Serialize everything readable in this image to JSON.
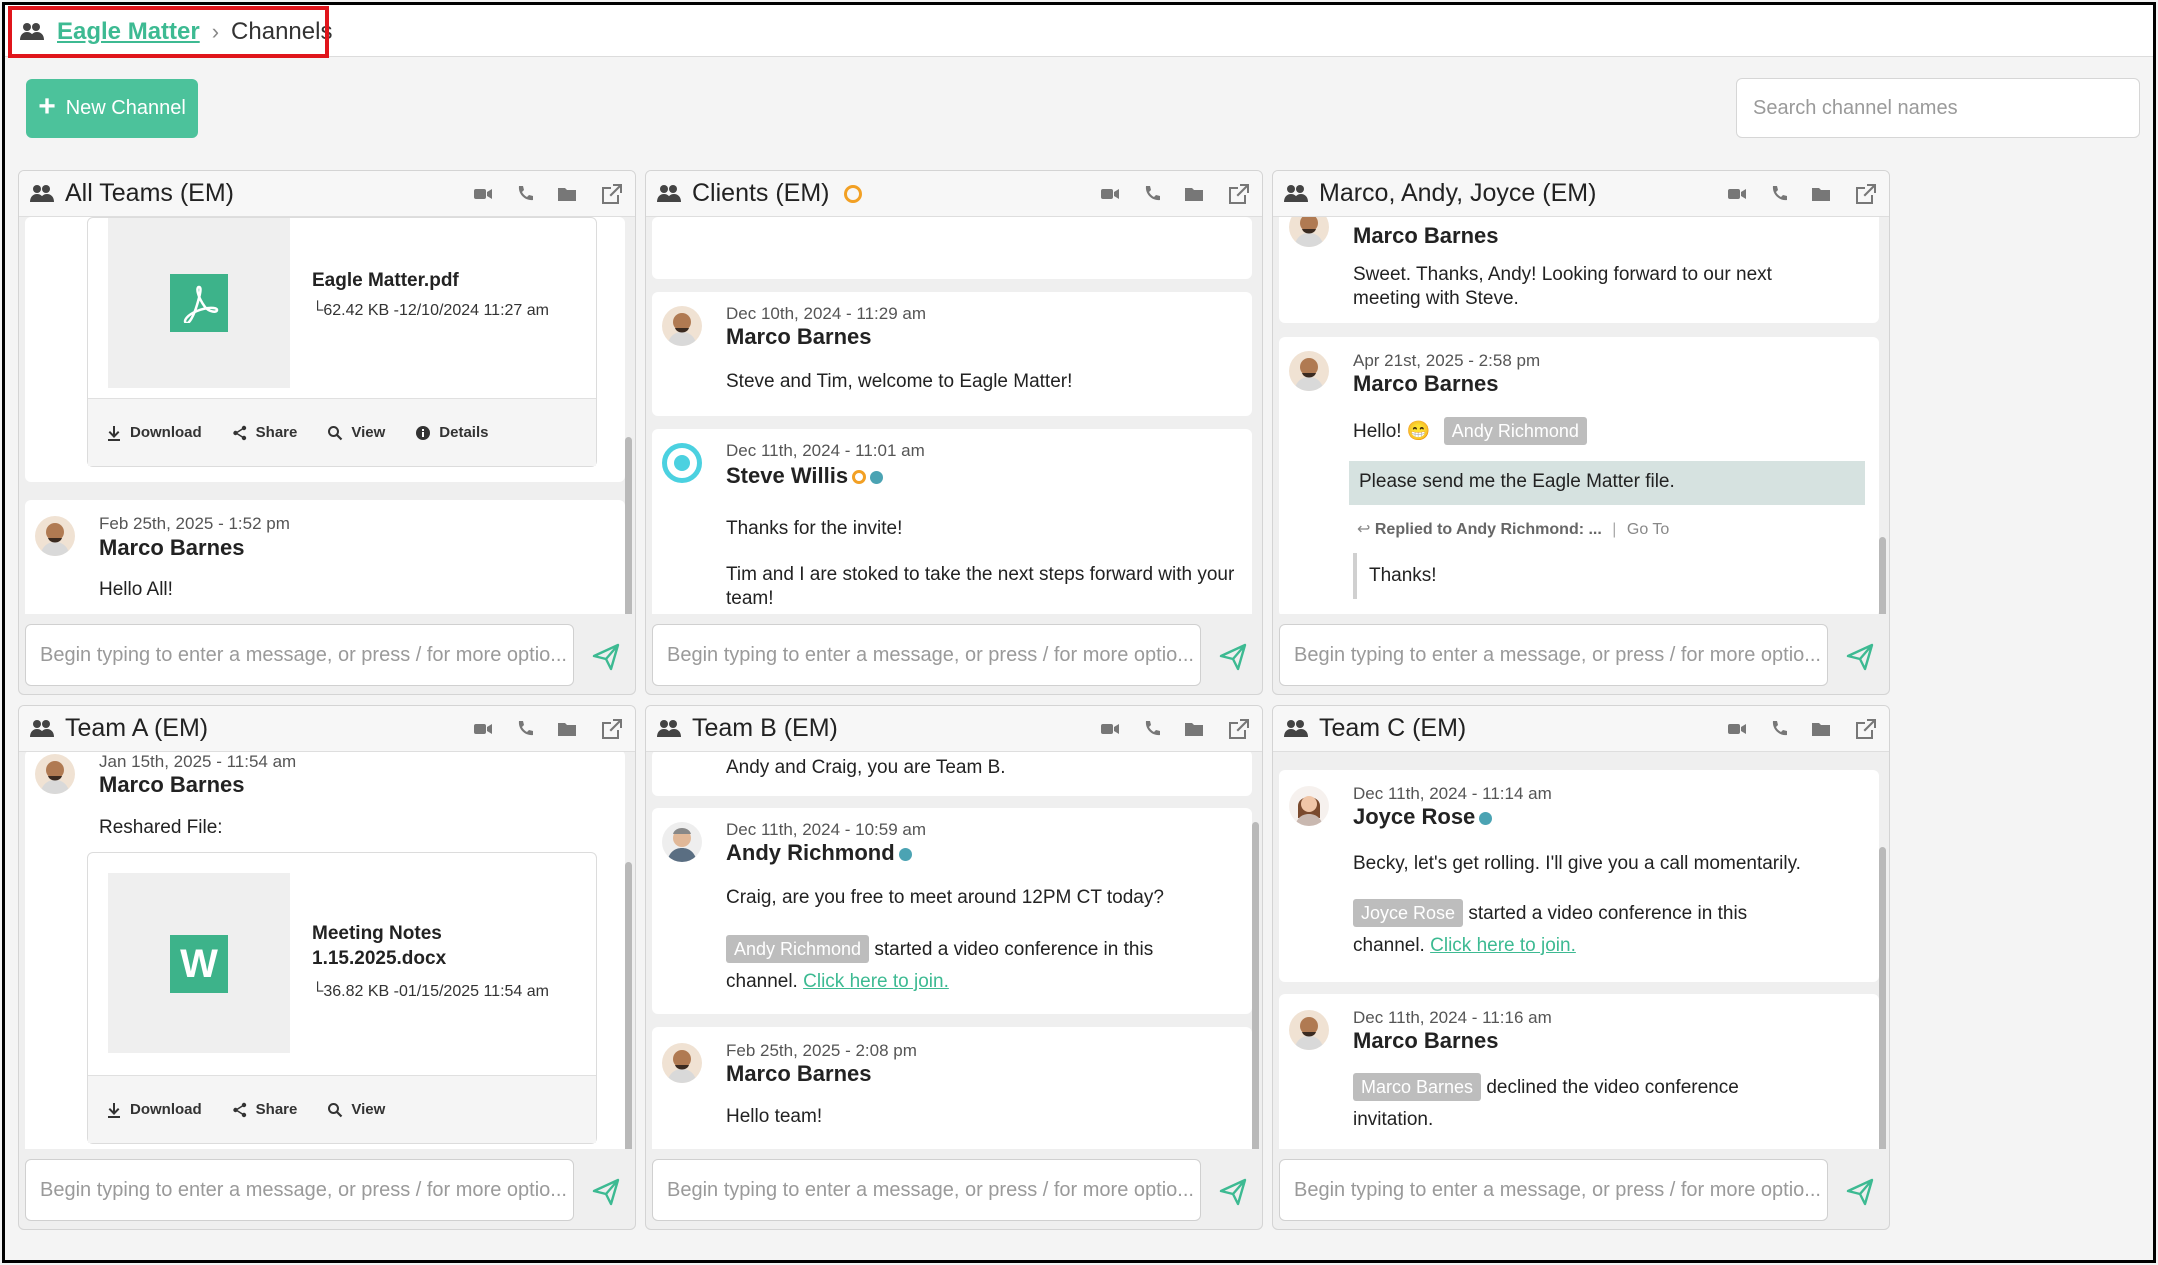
{
  "breadcrumb": {
    "parent": "Eagle Matter",
    "separator": "›",
    "current": "Channels"
  },
  "toolbar": {
    "new_channel_label": "New Channel",
    "search_placeholder": "Search channel names"
  },
  "composer_placeholder": "Begin typing to enter a message, or press / for more optio...",
  "colors": {
    "accent": "#4cc29b",
    "link": "#3dba92",
    "highlight": "#e0151b"
  },
  "panels": [
    {
      "title": "All Teams (EM)",
      "file": {
        "name": "Eagle Matter.pdf",
        "size": "└62.42 KB -12/10/2024 11:27 am",
        "actions": [
          "Download",
          "Share",
          "View",
          "Details"
        ]
      },
      "messages": [
        {
          "time": "Feb 25th, 2025 - 1:52 pm",
          "author": "Marco Barnes",
          "text": "Hello All!"
        }
      ]
    },
    {
      "title": "Clients (EM)",
      "messages": [
        {
          "time": "Dec 10th, 2024 - 11:29 am",
          "author": "Marco Barnes",
          "text": "Steve and Tim, welcome to Eagle Matter!"
        },
        {
          "time": "Dec 11th, 2024 - 11:01 am",
          "author": "Steve Willis",
          "text": "Thanks for the invite!",
          "text2": "Tim and I are stoked to take the next steps forward with your team!"
        }
      ]
    },
    {
      "title": "Marco, Andy, Joyce (EM)",
      "messages": [
        {
          "author": "Marco Barnes",
          "text": "Sweet. Thanks, Andy! Looking forward to our next meeting with Steve."
        },
        {
          "time": "Apr 21st, 2025 - 2:58 pm",
          "author": "Marco Barnes",
          "text": "Hello! 😁",
          "mention": "Andy Richmond",
          "quote": "Please send me the Eagle Matter file.",
          "replied": "Replied to Andy Richmond: ...",
          "goto": "Go To",
          "reply": "Thanks!"
        }
      ]
    },
    {
      "title": "Team A (EM)",
      "messages": [
        {
          "time": "Jan 15th, 2025 - 11:54 am",
          "author": "Marco Barnes",
          "text": "Reshared File:"
        }
      ],
      "file": {
        "name": "Meeting Notes 1.15.2025.docx",
        "size": "└36.82 KB -01/15/2025 11:54 am",
        "actions": [
          "Download",
          "Share",
          "View"
        ]
      }
    },
    {
      "title": "Team B (EM)",
      "messages": [
        {
          "text": "Andy and Craig, you are Team B."
        },
        {
          "time": "Dec 11th, 2024 - 10:59 am",
          "author": "Andy Richmond",
          "text": "Craig, are you free to meet around 12PM CT today?",
          "chip": "Andy Richmond",
          "after_chip": "started a video conference in this",
          "line2": "channel.",
          "link": "Click here to join."
        },
        {
          "time": "Feb 25th, 2025 - 2:08 pm",
          "author": "Marco Barnes",
          "text": "Hello team!"
        }
      ]
    },
    {
      "title": "Team C (EM)",
      "messages": [
        {
          "time": "Dec 11th, 2024 - 11:14 am",
          "author": "Joyce Rose",
          "text": "Becky, let's get rolling. I'll give you a call momentarily.",
          "chip": "Joyce Rose",
          "after_chip": "started a video conference in this",
          "line2": "channel.",
          "link": "Click here to join."
        },
        {
          "time": "Dec 11th, 2024 - 11:16 am",
          "author": "Marco Barnes",
          "chip": "Marco Barnes",
          "after_chip": "declined the video conference",
          "line2": "invitation."
        }
      ]
    }
  ]
}
